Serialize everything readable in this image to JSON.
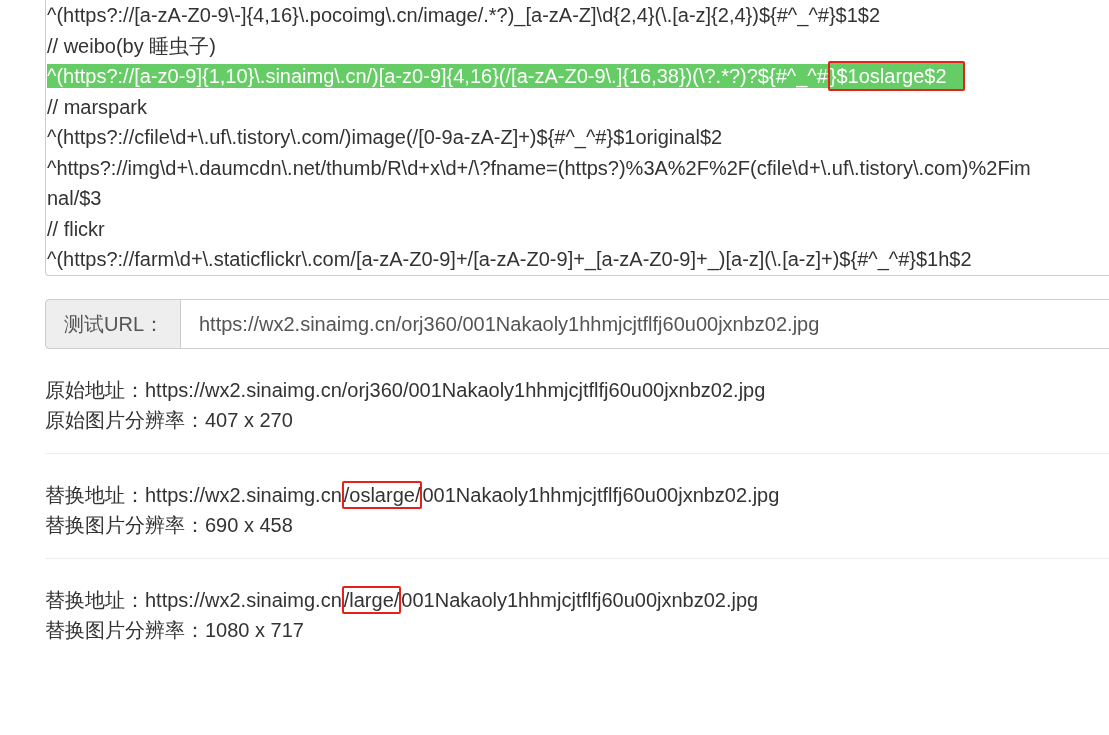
{
  "rules_editor": {
    "lines": [
      {
        "highlighted": false,
        "segments": [
          {
            "text": "^(https?://[a-zA-Z0-9\\-]{4,16}\\.pocoimg\\.cn/image/.*?)_[a-zA-Z]\\d{2,4}(\\.[a-z]{2,4})${#^_^#}$1$2",
            "boxed": false
          }
        ]
      },
      {
        "highlighted": false,
        "segments": [
          {
            "text": "// weibo(by 睡虫子)",
            "boxed": false
          }
        ]
      },
      {
        "highlighted": true,
        "segments": [
          {
            "text": "^(https?://[a-z0-9]{1,10}\\.sinaimg\\.cn/)[a-z0-9]{4,16}(/[a-zA-Z0-9\\.]{16,38})(\\?.*?)?${#^_^#",
            "boxed": false
          },
          {
            "text": "}$1oslarge$2",
            "boxed": true
          }
        ]
      },
      {
        "highlighted": false,
        "segments": [
          {
            "text": "// marspark",
            "boxed": false
          }
        ]
      },
      {
        "highlighted": false,
        "segments": [
          {
            "text": "^(https?://cfile\\d+\\.uf\\.tistory\\.com/)image(/[0-9a-zA-Z]+)${#^_^#}$1original$2",
            "boxed": false
          }
        ]
      },
      {
        "highlighted": false,
        "segments": [
          {
            "text": "^https?://img\\d+\\.daumcdn\\.net/thumb/R\\d+x\\d+/\\?fname=(https?)%3A%2F%2F(cfile\\d+\\.uf\\.tistory\\.com)%2Fim",
            "boxed": false
          }
        ]
      },
      {
        "highlighted": false,
        "segments": [
          {
            "text": "nal/$3",
            "boxed": false
          }
        ]
      },
      {
        "highlighted": false,
        "segments": [
          {
            "text": "// flickr",
            "boxed": false
          }
        ]
      },
      {
        "highlighted": false,
        "segments": [
          {
            "text": "^(https?://farm\\d+\\.staticflickr\\.com/[a-zA-Z0-9]+/[a-zA-Z0-9]+_[a-zA-Z0-9]+_)[a-z](\\.[a-z]+)${#^_^#}$1h$2",
            "boxed": false
          }
        ]
      }
    ]
  },
  "test_url": {
    "label": "测试URL：",
    "value": "https://wx2.sinaimg.cn/orj360/001Nakaoly1hhmjcjtflfj60u00jxnbz02.jpg"
  },
  "results": [
    {
      "address_label": "原始地址：",
      "address": [
        {
          "text": "https://wx2.sinaimg.cn/orj360/001Nakaoly1hhmjcjtflfj60u00jxnbz02.jpg",
          "boxed": false
        }
      ],
      "resolution_label": "原始图片分辨率：",
      "resolution": "407 x 270"
    },
    {
      "address_label": "替换地址：",
      "address": [
        {
          "text": "https://wx2.sinaimg.cn",
          "boxed": false
        },
        {
          "text": "/oslarge/",
          "boxed": true
        },
        {
          "text": "001Nakaoly1hhmjcjtflfj60u00jxnbz02.jpg",
          "boxed": false
        }
      ],
      "resolution_label": "替换图片分辨率：",
      "resolution": "690 x 458"
    },
    {
      "address_label": "替换地址：",
      "address": [
        {
          "text": "https://wx2.sinaimg.cn",
          "boxed": false
        },
        {
          "text": "/large/",
          "boxed": true
        },
        {
          "text": "001Nakaoly1hhmjcjtflfj60u00jxnbz02.jpg",
          "boxed": false
        }
      ],
      "resolution_label": "替换图片分辨率：",
      "resolution": "1080 x 717"
    }
  ]
}
